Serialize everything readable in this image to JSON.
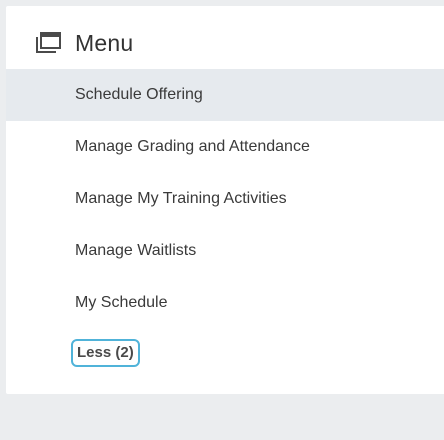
{
  "menu": {
    "title": "Menu",
    "icon": "window-stack-icon",
    "items": [
      {
        "label": "Schedule Offering",
        "active": true
      },
      {
        "label": "Manage Grading and Attendance",
        "active": false
      },
      {
        "label": "Manage My Training Activities",
        "active": false
      },
      {
        "label": "Manage Waitlists",
        "active": false
      },
      {
        "label": "My Schedule",
        "active": false
      }
    ],
    "less_label": "Less (2)"
  },
  "colors": {
    "page_background": "#ebedef",
    "card_background": "#ffffff",
    "active_item_background": "#e6eaee",
    "focus_border": "#50b3d9"
  }
}
